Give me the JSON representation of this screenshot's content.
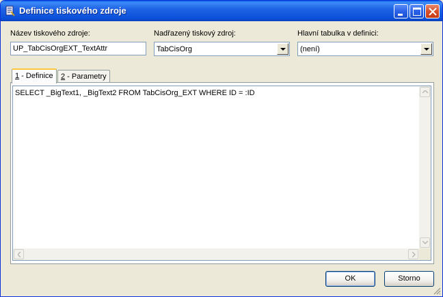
{
  "window": {
    "title": "Definice tiskového zdroje",
    "controls": [
      "minimize-icon",
      "maximize-icon",
      "close-icon"
    ]
  },
  "form": {
    "source_name_label": "Název tiskového zdroje:",
    "source_name_value": "UP_TabCisOrgEXT_TextAttr",
    "parent_source_label": "Nadřazený tiskový zdroj:",
    "parent_source_value": "TabCisOrg",
    "main_table_label": "Hlavní tabulka v definici:",
    "main_table_value": "(není)"
  },
  "tabs": [
    {
      "hotkey": "1",
      "label": " - Definice",
      "active": true
    },
    {
      "hotkey": "2",
      "label": " - Parametry",
      "active": false
    }
  ],
  "editor": {
    "sql": "SELECT _BigText1, _BigText2 FROM TabCisOrg_EXT WHERE ID = :ID"
  },
  "buttons": {
    "ok_label": "OK",
    "cancel_label": "Storno"
  }
}
